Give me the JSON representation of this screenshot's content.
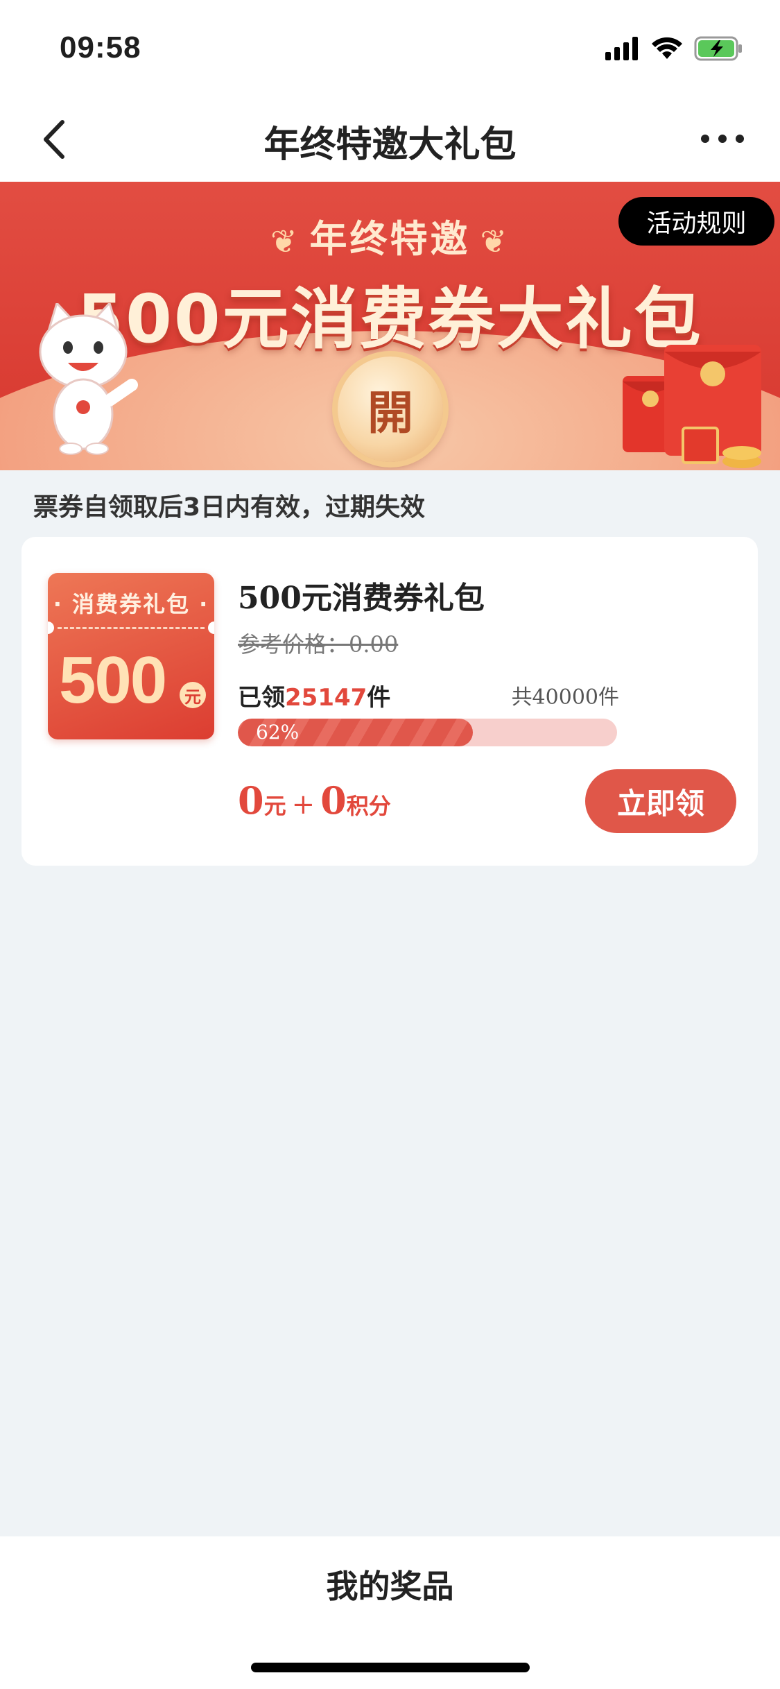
{
  "status_bar": {
    "time": "09:58"
  },
  "nav": {
    "title": "年终特邀大礼包"
  },
  "banner": {
    "subtitle": "年终特邀",
    "main_title": "500元消费券大礼包",
    "open_label": "開",
    "rules_label": "活动规则"
  },
  "notice": "票券自领取后3日内有效，过期失效",
  "item": {
    "coupon_top_label": "消费券礼包",
    "coupon_amount": "500",
    "coupon_unit": "元",
    "title": "500元消费券礼包",
    "ref_price": "参考价格：0.00",
    "claimed_prefix": "已领",
    "claimed_count": "25147",
    "claimed_suffix": "件",
    "total": "共40000件",
    "progress_percent": 62,
    "progress_label": "62%",
    "price_yuan": "0",
    "price_yuan_unit": "元",
    "price_plus": "+",
    "price_points": "0",
    "price_points_unit": "积分",
    "claim_button": "立即领"
  },
  "bottom": {
    "my_prizes": "我的奖品"
  },
  "colors": {
    "accent": "#e05749",
    "background": "#eff3f6",
    "progress_bg": "#f7cfcc"
  }
}
